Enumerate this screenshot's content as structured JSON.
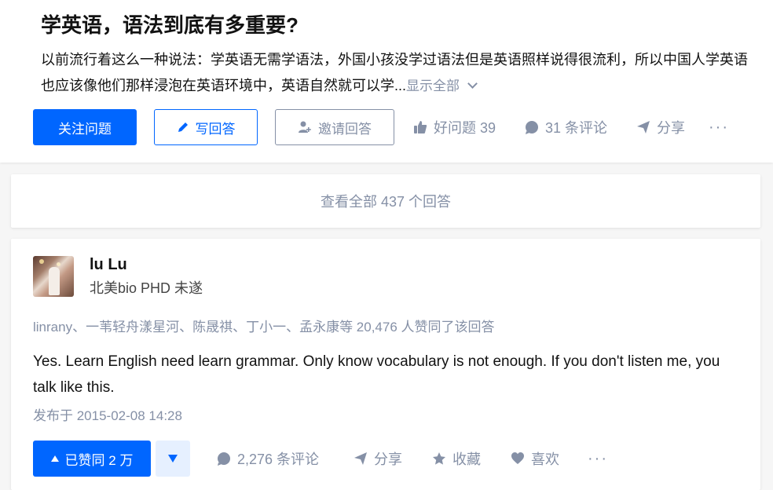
{
  "question": {
    "title": "学英语，语法到底有多重要?",
    "description": "以前流行着这么一种说法：学英语无需学语法，外国小孩没学过语法但是英语照样说得很流利，所以中国人学英语也应该像他们那样浸泡在英语环境中，英语自然就可以学...",
    "show_all_label": "显示全部"
  },
  "actions": {
    "follow_label": "关注问题",
    "write_label": "写回答",
    "invite_label": "邀请回答",
    "good_question_label": "好问题 39",
    "comments_label": "31 条评论",
    "share_label": "分享",
    "more_label": "···"
  },
  "view_all_label": "查看全部 437 个回答",
  "answer": {
    "author_name": "lu Lu",
    "author_bio": "北美bio PHD 未遂",
    "voters_text": "linrany、一苇轻舟漾星河、陈晟祺、丁小一、孟永康等 20,476 人赞同了该回答",
    "content": "Yes. Learn English need learn grammar. Only know vocabulary is not enough. If you don't listen me, you talk like this.",
    "date": "发布于 2015-02-08 14:28",
    "upvote_label": "已赞同 2 万",
    "comments_label": "2,276 条评论",
    "share_label": "分享",
    "collect_label": "收藏",
    "like_label": "喜欢",
    "more_label": "···"
  },
  "colors": {
    "brand": "#0066ff",
    "muted": "#8590a6",
    "text": "#121212"
  }
}
